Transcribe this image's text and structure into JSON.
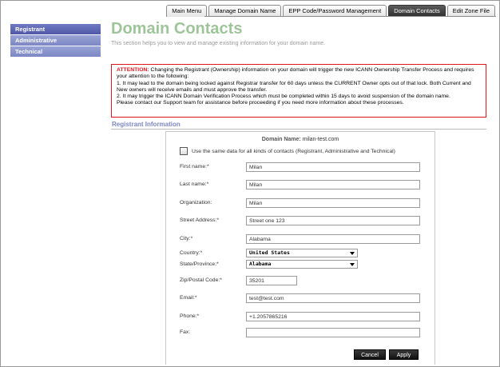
{
  "tabs": [
    {
      "label": "Main Menu",
      "active": false
    },
    {
      "label": "Manage Domain Name",
      "active": false
    },
    {
      "label": "EPP Code/Password Management",
      "active": false
    },
    {
      "label": "Domain Contacts",
      "active": true
    },
    {
      "label": "Edit Zone File",
      "active": false
    }
  ],
  "sidebar": {
    "items": [
      {
        "label": "Registrant",
        "active": true
      },
      {
        "label": "Administrative",
        "active": false
      },
      {
        "label": "Technical",
        "active": false
      }
    ]
  },
  "header": {
    "title": "Domain Contacts",
    "subtitle": "This section helps you to view and manage existing information for your domain name."
  },
  "attention": {
    "label": "ATTENTION:",
    "lead": " Changing the Registrant (Ownership) information on your domain will trigger the new ICANN Ownership Transfer Process and requires your attention to the following:",
    "point1": "1. It may lead to the domain being locked against Registrar transfer for 60 days unless the CURRENT Owner opts out of that lock. Both Current and New owners will receive emails and must approve the transfer.",
    "point2": "2. It may trigger the ICANN Domain Verification Process which must be completed within 15 days to avoid suspension of the domain name.",
    "point3": "Please contact our Support team for assistance before proceeding if you need more information about these processes."
  },
  "section": {
    "title": "Registrant Information"
  },
  "form": {
    "domain_label": "Domain Name:",
    "domain_value": "milan-test.com",
    "same_data_label": "Use the same data for all kinds of contacts (Registrant, Administrative and Technical)",
    "first_name": {
      "label": "First name:*",
      "value": "Milan"
    },
    "last_name": {
      "label": "Last name:*",
      "value": "Milan"
    },
    "organization": {
      "label": "Organization:",
      "value": "Milan"
    },
    "street": {
      "label": "Street Address:*",
      "value": "Street one 123"
    },
    "city": {
      "label": "City:*",
      "value": "Alabama"
    },
    "country": {
      "label": "Country:*",
      "value": "United States"
    },
    "state": {
      "label": "State/Province:*",
      "value": "Alabama"
    },
    "zip": {
      "label": "Zip/Postal Code:*",
      "value": "35201"
    },
    "email": {
      "label": "Email:*",
      "value": "test@test.com"
    },
    "phone": {
      "label": "Phone:*",
      "value": "+1.2057865216"
    },
    "fax": {
      "label": "Fax:",
      "value": ""
    },
    "cancel_label": "Cancel",
    "apply_label": "Apply"
  }
}
